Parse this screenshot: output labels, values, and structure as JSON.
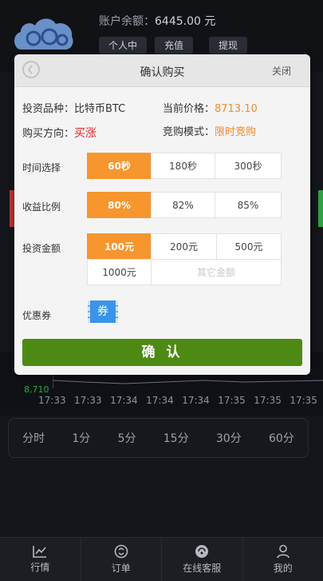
{
  "account": {
    "balance_label": "账户余额：",
    "balance_value": "6445.00 元",
    "buttons": [
      "个人中心",
      "充值",
      "提现"
    ]
  },
  "modal": {
    "title": "确认购买",
    "close_label": "关闭",
    "product_label": "投资品种：",
    "product_value": "比特币BTC",
    "price_label": "当前价格：",
    "price_value": "8713.10",
    "direction_label": "购买方向：",
    "direction_value": "买涨",
    "mode_label": "竞购模式：",
    "mode_value": "限时竞购",
    "time_label": "时间选择",
    "time_options": [
      "60秒",
      "180秒",
      "300秒"
    ],
    "time_selected": "60秒",
    "ratio_label": "收益比例",
    "ratio_options": [
      "80%",
      "82%",
      "85%"
    ],
    "ratio_selected": "80%",
    "amount_label": "投资金额",
    "amount_options": [
      "100元",
      "200元",
      "500元",
      "1000元"
    ],
    "amount_selected": "100元",
    "amount_other_placeholder": "其它金额",
    "coupon_label": "优惠券",
    "coupon_icon_text": "券",
    "confirm_label": "确 认"
  },
  "chart": {
    "price_label": "8,710",
    "time_ticks": [
      "17:33",
      "17:33",
      "17:34",
      "17:34",
      "17:34",
      "17:35",
      "17:35",
      "17:35"
    ]
  },
  "periods": [
    "分时",
    "1分",
    "5分",
    "15分",
    "30分",
    "60分"
  ],
  "tabbar": [
    {
      "label": "行情",
      "icon": "chart-icon"
    },
    {
      "label": "订单",
      "icon": "order-icon"
    },
    {
      "label": "在线客服",
      "icon": "service-icon"
    },
    {
      "label": "我的",
      "icon": "user-icon"
    }
  ],
  "colors": {
    "accent_orange": "#f7962e",
    "confirm_green": "#4d8a13",
    "up_red": "#e0262b"
  }
}
